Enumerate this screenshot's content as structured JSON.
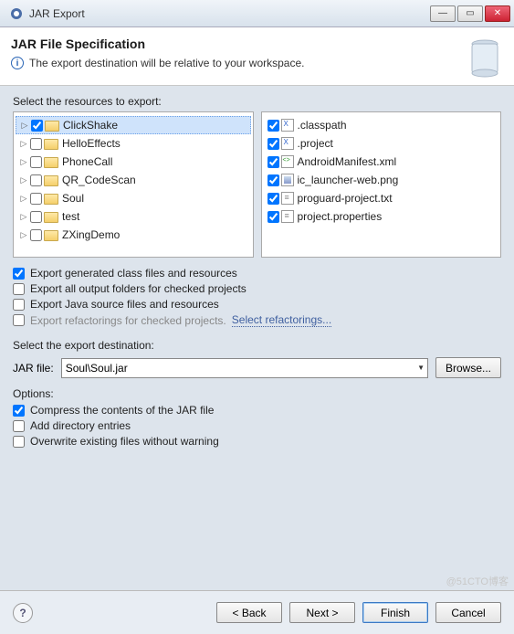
{
  "window": {
    "title": "JAR Export"
  },
  "banner": {
    "title": "JAR File Specification",
    "message": "The export destination will be relative to your workspace."
  },
  "labels": {
    "resources": "Select the resources to export:",
    "destination": "Select the export destination:",
    "jar_file": "JAR file:",
    "options": "Options:",
    "browse": "Browse...",
    "back": "< Back",
    "next": "Next >",
    "finish": "Finish",
    "cancel": "Cancel",
    "select_refactorings": "Select refactorings..."
  },
  "projects": [
    {
      "name": "ClickShake",
      "checked": true,
      "selected": true
    },
    {
      "name": "HelloEffects",
      "checked": false
    },
    {
      "name": "PhoneCall",
      "checked": false
    },
    {
      "name": "QR_CodeScan",
      "checked": false
    },
    {
      "name": "Soul",
      "checked": false
    },
    {
      "name": "test",
      "checked": false
    },
    {
      "name": "ZXingDemo",
      "checked": false
    }
  ],
  "files": [
    {
      "name": ".classpath",
      "checked": true,
      "kind": "x"
    },
    {
      "name": ".project",
      "checked": true,
      "kind": "x"
    },
    {
      "name": "AndroidManifest.xml",
      "checked": true,
      "kind": "xml"
    },
    {
      "name": "ic_launcher-web.png",
      "checked": true,
      "kind": "img"
    },
    {
      "name": "proguard-project.txt",
      "checked": true,
      "kind": "txt"
    },
    {
      "name": "project.properties",
      "checked": true,
      "kind": "txt"
    }
  ],
  "export_options": {
    "generated_class": {
      "label": "Export generated class files and resources",
      "checked": true
    },
    "all_output": {
      "label": "Export all output folders for checked projects",
      "checked": false
    },
    "java_source": {
      "label": "Export Java source files and resources",
      "checked": false
    },
    "refactorings": {
      "label": "Export refactorings for checked projects.",
      "checked": false
    }
  },
  "jar_path": "Soul\\Soul.jar",
  "options": {
    "compress": {
      "label": "Compress the contents of the JAR file",
      "checked": true
    },
    "add_dir": {
      "label": "Add directory entries",
      "checked": false
    },
    "overwrite": {
      "label": "Overwrite existing files without warning",
      "checked": false
    }
  },
  "watermark": "@51CTO博客"
}
